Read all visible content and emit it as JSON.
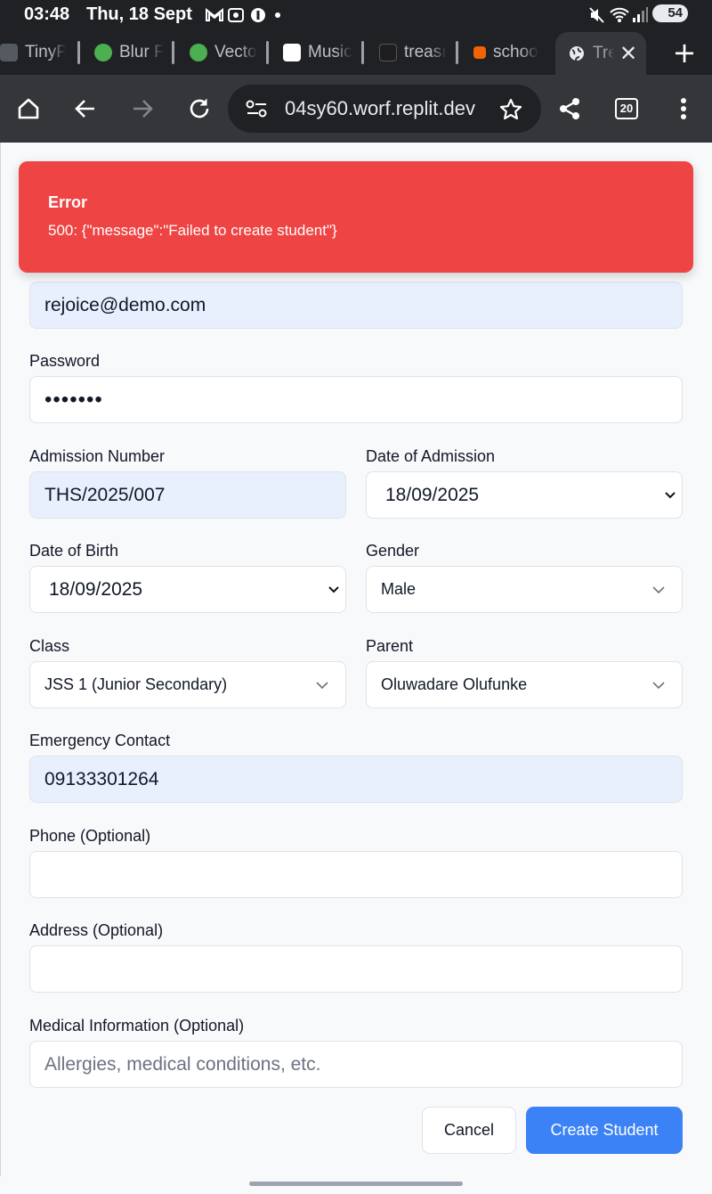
{
  "status_bar": {
    "time": "03:48",
    "date": "Thu, 18 Sept",
    "battery": "54"
  },
  "tabs": [
    {
      "title": "TinyP",
      "favicon_color": "#555a60"
    },
    {
      "title": "Blur F",
      "favicon_color": "#4caf50"
    },
    {
      "title": "Vecto",
      "favicon_color": "#4caf50"
    },
    {
      "title": "Music",
      "favicon_color": "#ffffff"
    },
    {
      "title": "treası",
      "favicon_color": "#1e1e1e"
    },
    {
      "title": "schoo",
      "favicon_color": "#f26207"
    },
    {
      "title": "Tre",
      "favicon_color": "#e8eaed",
      "active": true
    }
  ],
  "toolbar": {
    "url": "04sy60.worf.replit.dev",
    "tab_count": "20"
  },
  "toast": {
    "title": "Error",
    "message": "500: {\"message\":\"Failed to create student\"}"
  },
  "form": {
    "email_value": "rejoice@demo.com",
    "password_label": "Password",
    "password_value": "•••••••",
    "admission_number_label": "Admission Number",
    "admission_number_value": "THS/2025/007",
    "date_of_admission_label": "Date of Admission",
    "date_of_admission_value": "18/09/2025",
    "date_of_birth_label": "Date of Birth",
    "date_of_birth_value": "18/09/2025",
    "gender_label": "Gender",
    "gender_value": "Male",
    "class_label": "Class",
    "class_value": "JSS 1 (Junior Secondary)",
    "parent_label": "Parent",
    "parent_value": "Oluwadare Olufunke",
    "emergency_contact_label": "Emergency Contact",
    "emergency_contact_value": "09133301264",
    "phone_label": "Phone (Optional)",
    "phone_value": "",
    "address_label": "Address (Optional)",
    "address_value": "",
    "medical_label": "Medical Information (Optional)",
    "medical_placeholder": "Allergies, medical conditions, etc."
  },
  "actions": {
    "cancel_label": "Cancel",
    "create_label": "Create Student"
  },
  "colors": {
    "error": "#ef4444",
    "primary": "#3b82f6",
    "autofill": "#e8f0fe"
  }
}
